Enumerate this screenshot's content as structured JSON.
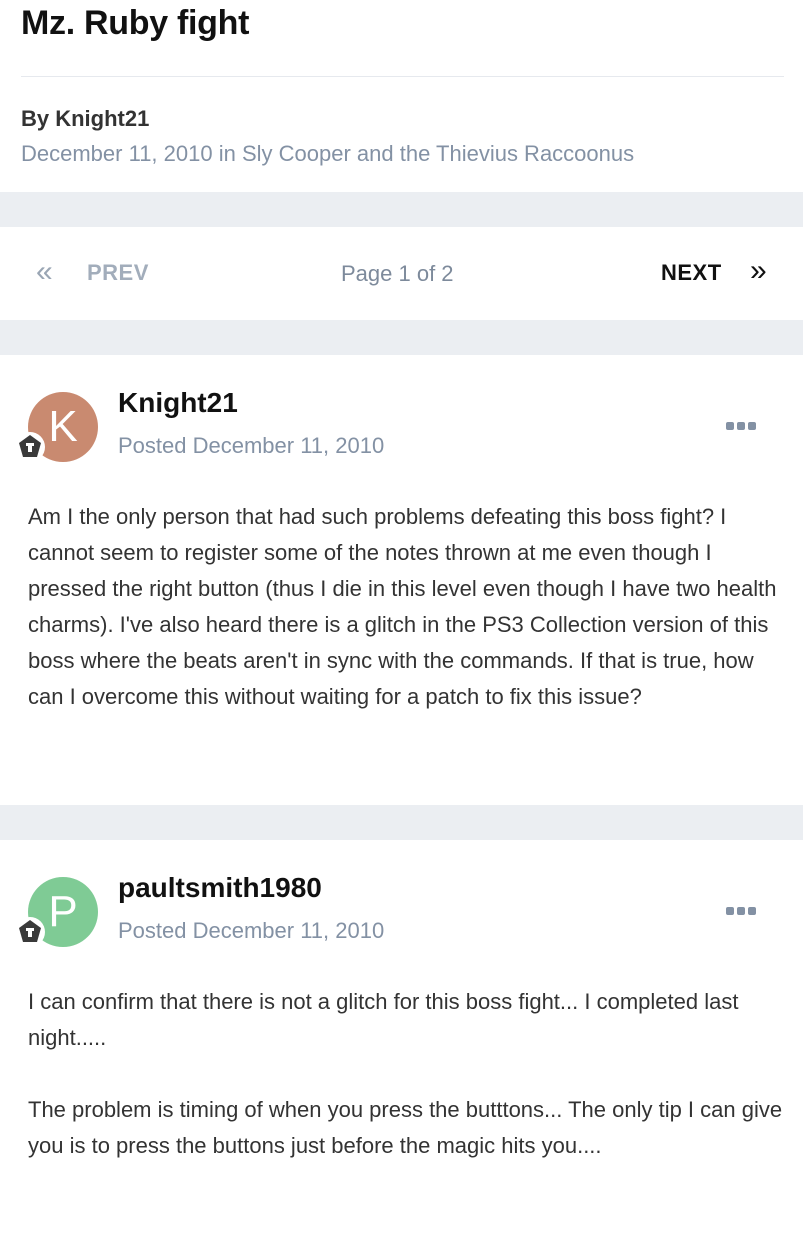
{
  "topic": {
    "title": "Mz. Ruby fight",
    "byline": "By Knight21",
    "date": "December 11, 2010",
    "in_text": " in ",
    "forum": "Sly Cooper and the Thievius Raccoonus"
  },
  "pagination": {
    "first_icon": "«",
    "prev_label": "PREV",
    "status": "Page 1 of 2",
    "next_label": "NEXT",
    "last_icon": "»"
  },
  "posts": [
    {
      "avatar_letter": "K",
      "avatar_color": "#c98a70",
      "author": "Knight21",
      "posted": "Posted December 11, 2010",
      "paragraphs": [
        "Am I the only person that had such problems defeating this boss fight? I cannot seem to register some of the notes thrown at me even though I pressed the right button (thus I die in this level even though I have two health charms). I've also heard there is a glitch in the PS3 Collection version of this boss where the beats aren't in sync with the commands. If that is true, how can I overcome this without waiting for a patch to fix this issue?"
      ]
    },
    {
      "avatar_letter": "P",
      "avatar_color": "#7fcb95",
      "author": "paultsmith1980",
      "posted": "Posted December 11, 2010",
      "paragraphs": [
        "I can confirm that there is not a glitch for this boss fight... I completed last night.....",
        "The problem is timing of when you press the butttons... The only tip I can give you is to press the buttons just before the magic hits you...."
      ]
    }
  ],
  "icons": {
    "rank": "rank-badge-icon",
    "menu": "ellipsis-menu-icon"
  }
}
